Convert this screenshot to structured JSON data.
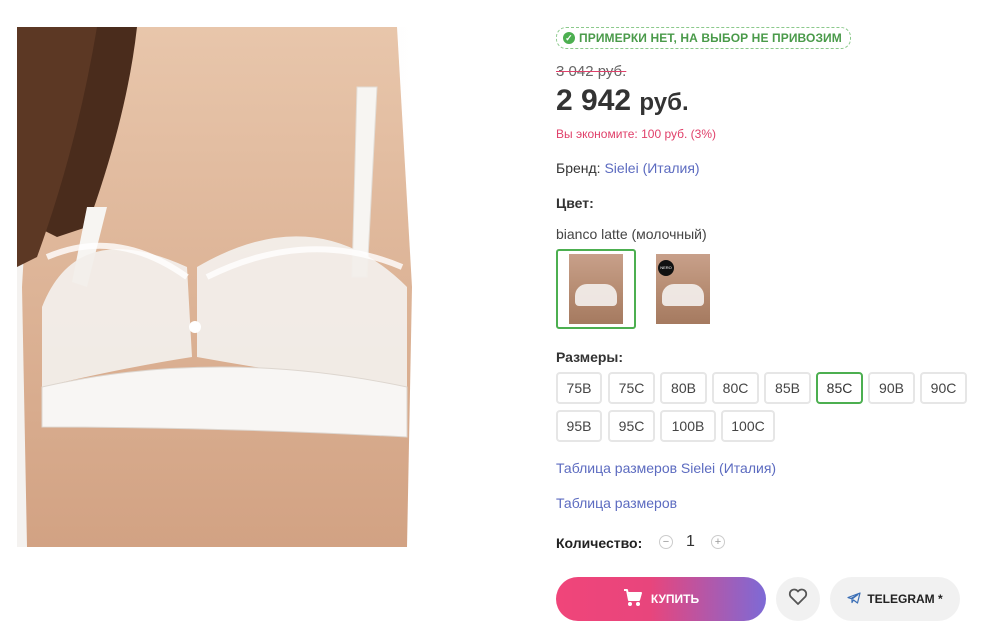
{
  "badge": {
    "text": "ПРИМЕРКИ НЕТ, НА ВЫБОР НЕ ПРИВОЗИМ",
    "icon": "check-circle-icon"
  },
  "price": {
    "old": "3 042 руб.",
    "current_amount": "2 942",
    "current_currency": "руб.",
    "economy": "Вы экономите: 100 руб. (3%)"
  },
  "brand": {
    "label": "Бренд:",
    "value": "Sielei (Италия)"
  },
  "color": {
    "title": "Цвет:",
    "selected_name": "bianco latte (молочный)",
    "variants": [
      {
        "tag": ""
      },
      {
        "tag": "NERO"
      }
    ]
  },
  "sizes": {
    "title": "Размеры:",
    "options": [
      "75B",
      "75C",
      "80B",
      "80C",
      "85B",
      "85C",
      "90B",
      "90C",
      "95B",
      "95C",
      "100B",
      "100C"
    ],
    "selected": "85C"
  },
  "links": {
    "brand_size_table": "Таблица размеров Sielei (Италия)",
    "size_table": "Таблица размеров"
  },
  "quantity": {
    "label": "Количество:",
    "value": "1",
    "minus": "−",
    "plus": "+"
  },
  "actions": {
    "buy": "КУПИТЬ",
    "telegram": "TELEGRAM *"
  },
  "colors": {
    "accent_green": "#4caf50",
    "link": "#5c6bc0",
    "sale": "#e0406a"
  }
}
